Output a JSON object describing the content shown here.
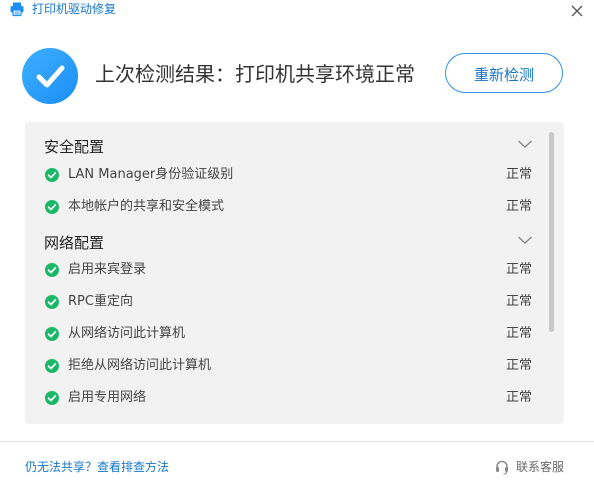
{
  "window": {
    "title": "打印机驱动修复",
    "app_icon": "printer-icon",
    "close_icon": "close-icon"
  },
  "header": {
    "status_icon": "check-circle-icon",
    "result_text": "上次检测结果：打印机共享环境正常",
    "recheck_label": "重新检测"
  },
  "sections": [
    {
      "title": "安全配置",
      "items": [
        {
          "label": "LAN Manager身份验证级别",
          "status": "正常"
        },
        {
          "label": "本地帐户的共享和安全模式",
          "status": "正常"
        }
      ]
    },
    {
      "title": "网络配置",
      "items": [
        {
          "label": "启用来宾登录",
          "status": "正常"
        },
        {
          "label": "RPC重定向",
          "status": "正常"
        },
        {
          "label": "从网络访问此计算机",
          "status": "正常"
        },
        {
          "label": "拒绝从网络访问此计算机",
          "status": "正常"
        },
        {
          "label": "启用专用网络",
          "status": "正常"
        }
      ]
    }
  ],
  "footer": {
    "help_link": "仍无法共享？查看排查方法",
    "support_label": "联系客服",
    "support_icon": "headset-icon"
  },
  "colors": {
    "accent": "#1677c8",
    "success": "#1cb86a",
    "panel_bg": "#f2f2f2"
  }
}
